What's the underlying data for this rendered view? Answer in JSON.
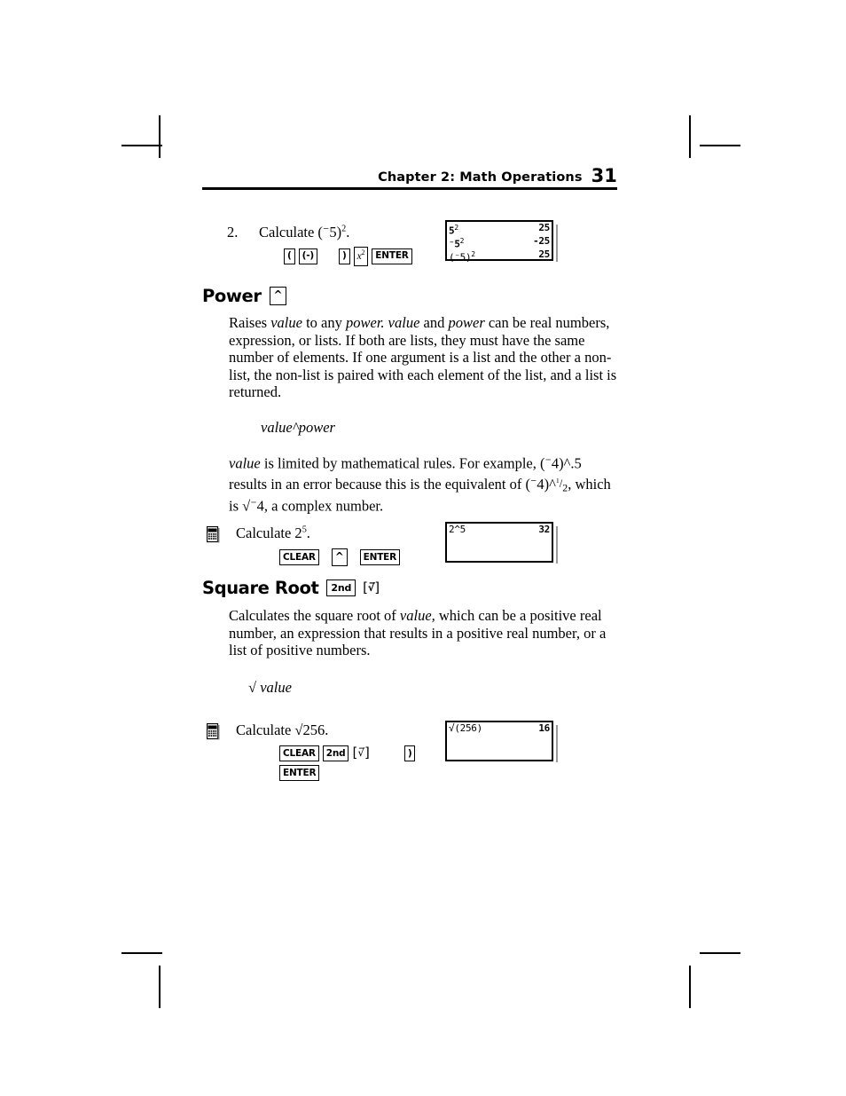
{
  "header": {
    "title": "Chapter 2: Math Operations",
    "page_number": "31"
  },
  "step": {
    "number": "2.",
    "text": "Calculate (-5)².",
    "keys": [
      "(",
      "(-)",
      ")",
      "x²",
      "ENTER"
    ]
  },
  "screens": {
    "negsquare": {
      "lines": [
        {
          "entry": "5²",
          "result": "25"
        },
        {
          "entry": "-5²",
          "result": "-25"
        },
        {
          "entry": "(-5)²",
          "result": "25"
        }
      ]
    },
    "power": {
      "lines": [
        {
          "entry": "2^5",
          "result": "32"
        }
      ]
    },
    "sqrt": {
      "lines": [
        {
          "entry": "√(256)",
          "result": "16"
        }
      ]
    }
  },
  "power_section": {
    "heading": "Power",
    "key": "^",
    "body": "Raises value to any power. value and power can be real numbers, expression, or lists. If both are lists, they must have the same number of elements. If one argument is a list and the other a non-list, the non-list is paired with each element of the list, and a list is returned.",
    "syntax": "value^power",
    "note": "value is limited by mathematical rules. For example, (-4)^.5 results in an error because this is the equivalent of (-4)^¹/₂, which is √-4, a complex number.",
    "example": {
      "icon": "calculator-icon",
      "text": "Calculate 2⁵.",
      "keys": [
        "CLEAR",
        "^",
        "ENTER"
      ]
    }
  },
  "sqrt_section": {
    "heading": "Square Root",
    "keys": [
      "2nd",
      "√"
    ],
    "body": "Calculates the square root of value, which can be a positive real number, an expression that results in a positive real number, or a list of positive numbers.",
    "syntax": "√ value",
    "example": {
      "icon": "calculator-icon",
      "text": "Calculate √256.",
      "keys_row1": [
        "CLEAR",
        "2nd",
        "√",
        ")"
      ],
      "keys_row2": [
        "ENTER"
      ]
    }
  },
  "colors": {
    "text": "#000000",
    "background": "#ffffff",
    "screen_shadow": "#9a9a9a"
  }
}
